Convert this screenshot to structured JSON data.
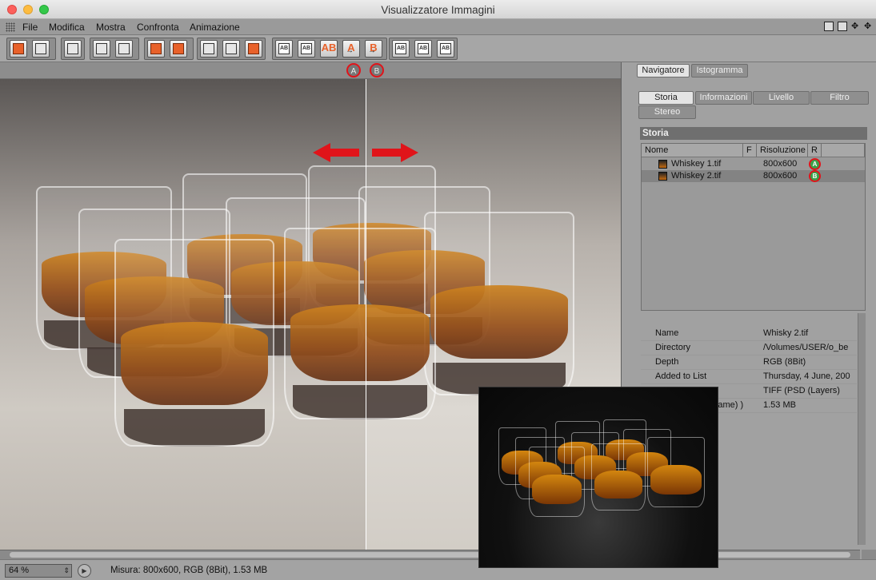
{
  "window": {
    "title": "Visualizzatore Immagini"
  },
  "menu": {
    "items": [
      "File",
      "Modifica",
      "Mostra",
      "Confronta",
      "Animazione"
    ]
  },
  "toolbar": {
    "a_label": "A",
    "b_label": "B",
    "ab_label": "AB"
  },
  "compare": {
    "marker_a": "A",
    "marker_b": "B",
    "accent_color": "#e0141a"
  },
  "sidebar": {
    "top_tabs": [
      "Navigatore",
      "Istogramma"
    ],
    "tabs": [
      "Storia",
      "Informazioni",
      "Livello",
      "Filtro",
      "Stereo"
    ],
    "section_title": "Storia",
    "columns": [
      "Nome",
      "F",
      "Risoluzione",
      "R"
    ],
    "rows": [
      {
        "name": "Whiskey 1.tif",
        "resolution": "800x600",
        "badge": "A"
      },
      {
        "name": "Whiskey  2.tif",
        "resolution": "800x600",
        "badge": "B"
      }
    ],
    "info": [
      {
        "key": "Name",
        "value": "Whisky 2.tif"
      },
      {
        "key": "Directory",
        "value": "/Volumes/USER/o_be"
      },
      {
        "key": "Depth",
        "value": "RGB (8Bit)"
      },
      {
        "key": "Added to List",
        "value": "Thursday, 4 June, 200"
      },
      {
        "key": "",
        "value": "TIFF (PSD (Layers)"
      },
      {
        "key": "Frame) )",
        "value": "1.53 MB"
      }
    ]
  },
  "status": {
    "zoom": "64 %",
    "text": "Misura: 800x600, RGB (8Bit), 1.53 MB"
  }
}
